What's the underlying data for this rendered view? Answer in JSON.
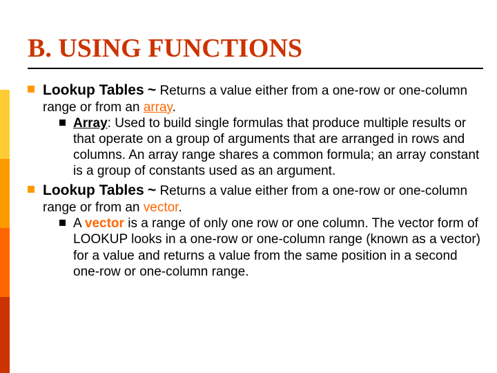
{
  "title": "B. USING FUNCTIONS",
  "items": [
    {
      "lead": "Lookup Tables",
      "tilde": "~",
      "tail1": " Returns a value either from a one-row or one-column range or from an ",
      "kw": "array",
      "tail2": ".",
      "sub": {
        "kw": "Array",
        "text": ": Used to build single formulas that produce multiple results or that operate on a group of arguments that are arranged in rows and columns. An array range shares a common formula; an array constant is a group of constants used as an argument."
      }
    },
    {
      "lead": "Lookup Tables",
      "tilde": "~",
      "tail1": " Returns a value either from a one-row or one-column range or from an ",
      "kw": "vector",
      "tail2": ".",
      "sub": {
        "pre": "A ",
        "kw": "vector",
        "text": " is a range of only one row or one column. The vector form of LOOKUP looks in a one-row or one-column range (known as a vector) for a value and returns a value from the same position in a second one-row or one-column range."
      }
    }
  ]
}
